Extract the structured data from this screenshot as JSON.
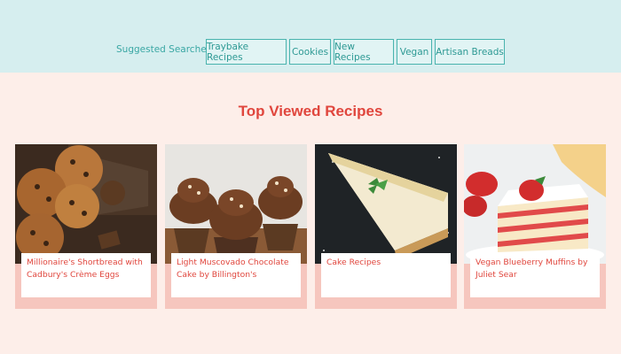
{
  "suggested": {
    "label": "Suggested Searches:",
    "chips": [
      "Traybake Recipes",
      "Cookies",
      "New Recipes",
      "Vegan",
      "Artisan Breads"
    ]
  },
  "main": {
    "title": "Top Viewed Recipes",
    "cards": [
      {
        "title": "Millionaire's Shortbread with Cadbury's Crème Eggs",
        "image": "chocolate-chip-cookies"
      },
      {
        "title": "Light Muscovado Chocolate Cake by Billington's",
        "image": "chocolate-cupcakes"
      },
      {
        "title": "Cake Recipes",
        "image": "cheesecake-slice"
      },
      {
        "title": "Vegan Blueberry Muffins by Juliet Sear",
        "image": "strawberry-layer-cake"
      }
    ]
  },
  "colors": {
    "topbar_bg": "#d6eeef",
    "page_bg": "#fdeee9",
    "accent_teal": "#49b3ae",
    "accent_red": "#e0463d",
    "card_bg": "#f6c6be"
  }
}
